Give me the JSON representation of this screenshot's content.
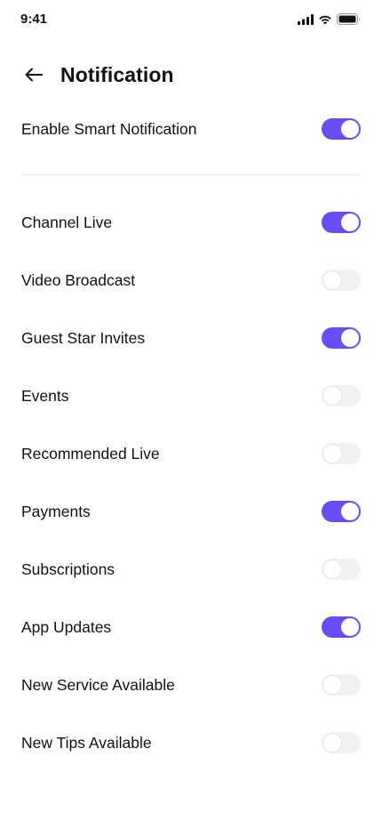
{
  "status_bar": {
    "time": "9:41",
    "icons": [
      "cellular-signal-icon",
      "wifi-icon",
      "battery-icon"
    ]
  },
  "header": {
    "back_icon": "arrow-left-icon",
    "title": "Notification"
  },
  "colors": {
    "accent": "#6a4cf5",
    "toggle_off": "#f1f1f2",
    "divider": "#e8e8ea",
    "text": "#111111"
  },
  "smart_notification": {
    "label": "Enable Smart Notification",
    "enabled": true
  },
  "settings": [
    {
      "label": "Channel Live",
      "enabled": true
    },
    {
      "label": "Video Broadcast",
      "enabled": false
    },
    {
      "label": "Guest Star Invites",
      "enabled": true
    },
    {
      "label": "Events",
      "enabled": false
    },
    {
      "label": "Recommended Live",
      "enabled": false
    },
    {
      "label": "Payments",
      "enabled": true
    },
    {
      "label": "Subscriptions",
      "enabled": false
    },
    {
      "label": "App Updates",
      "enabled": true
    },
    {
      "label": "New Service Available",
      "enabled": false
    },
    {
      "label": "New Tips Available",
      "enabled": false
    }
  ]
}
